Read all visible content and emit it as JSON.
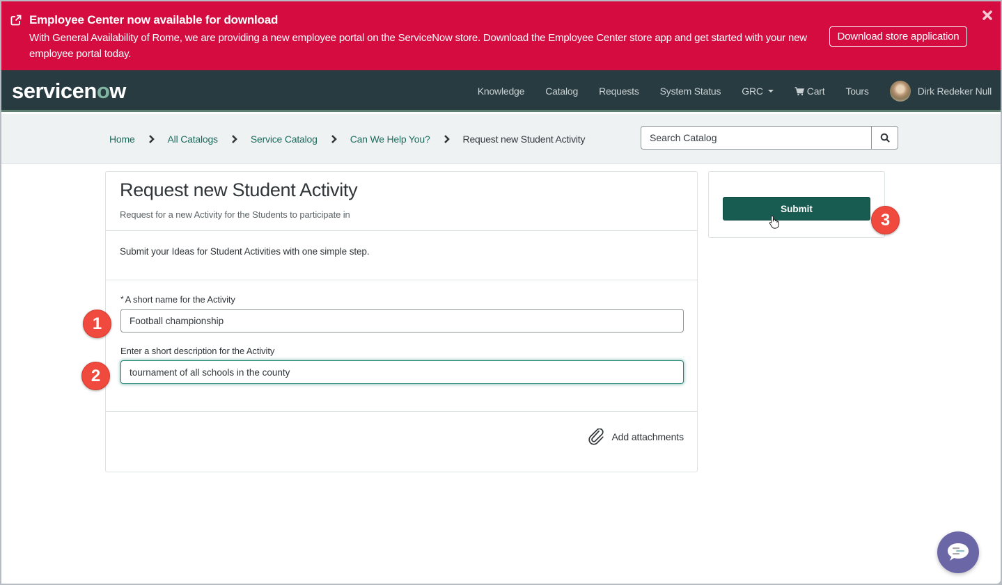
{
  "banner": {
    "title": "Employee Center now available for download",
    "body": "With General Availability of Rome, we are providing a new employee portal on the ServiceNow store. Download the Employee Center store app and get started with your new employee portal today.",
    "download_label": "Download store application",
    "icons": {
      "external": "external-link-icon",
      "close": "close-icon"
    },
    "color": "#d40c40"
  },
  "navbar": {
    "logo": {
      "pre": "servicen",
      "o": "o",
      "post": "w"
    },
    "links": [
      {
        "label": "Knowledge"
      },
      {
        "label": "Catalog"
      },
      {
        "label": "Requests"
      },
      {
        "label": "System Status"
      },
      {
        "label": "GRC",
        "dropdown": true
      },
      {
        "label": "Cart",
        "icon": "cart-icon"
      },
      {
        "label": "Tours"
      }
    ],
    "user": {
      "name": "Dirk Redeker Null"
    },
    "color": "#283b41"
  },
  "breadcrumb": {
    "items": [
      "Home",
      "All Catalogs",
      "Service Catalog",
      "Can We Help You?"
    ],
    "current": "Request new Student Activity"
  },
  "search": {
    "placeholder": "Search Catalog",
    "icon": "search-icon"
  },
  "form": {
    "title": "Request new Student Activity",
    "subtitle": "Request for a new Activity for the Students to participate in",
    "intro": "Submit your Ideas for Student Activities with one simple step.",
    "fields": [
      {
        "label": "A short name for the Activity",
        "required": true,
        "required_mark": "*",
        "value": "Football championship"
      },
      {
        "label": "Enter a short description for the Activity",
        "required": false,
        "value": "tournament of all schools in the county"
      }
    ],
    "attachments_label": "Add attachments"
  },
  "side": {
    "submit_label": "Submit",
    "accent": "#185b50"
  },
  "steps": [
    "1",
    "2",
    "3"
  ],
  "chat": {
    "icon": "chat-bubble-icon",
    "color": "#6b67a7"
  }
}
